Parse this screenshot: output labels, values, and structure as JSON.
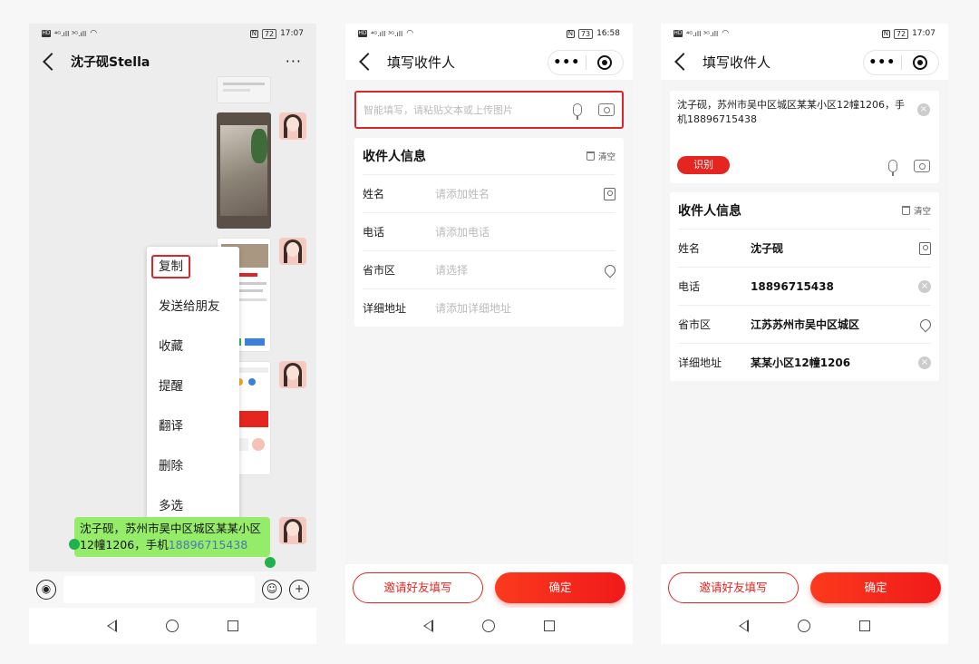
{
  "status": {
    "p1_time": "17:07",
    "p1_battery": "72",
    "p2_time": "16:58",
    "p2_battery": "73",
    "p3_time": "17:07",
    "p3_battery": "72"
  },
  "chat": {
    "contact_name": "沈子砚Stella",
    "message_part1": "沈子砚，苏州市吴中区城区某某小区12幢1206，手机",
    "message_phone": "18896715438",
    "context_menu": [
      "复制",
      "发送给朋友",
      "收藏",
      "提醒",
      "翻译",
      "删除",
      "多选"
    ]
  },
  "form_empty": {
    "title": "填写收件人",
    "smart_placeholder": "智能填写，请粘贴文本或上传图片",
    "section_title": "收件人信息",
    "clear_label": "清空",
    "rows": [
      {
        "label": "姓名",
        "value": "请添加姓名"
      },
      {
        "label": "电话",
        "value": "请添加电话"
      },
      {
        "label": "省市区",
        "value": "请选择"
      },
      {
        "label": "详细地址",
        "value": "请添加详细地址"
      }
    ],
    "invite_label": "邀请好友填写",
    "confirm_label": "确定"
  },
  "form_filled": {
    "title": "填写收件人",
    "pasted_text": "沈子砚，苏州市吴中区城区某某小区12幢1206，手机18896715438",
    "recognize_label": "识别",
    "section_title": "收件人信息",
    "clear_label": "清空",
    "rows": [
      {
        "label": "姓名",
        "value": "沈子砚"
      },
      {
        "label": "电话",
        "value": "18896715438"
      },
      {
        "label": "省市区",
        "value": "江苏苏州市吴中区城区"
      },
      {
        "label": "详细地址",
        "value": "某某小区12幢1206"
      }
    ],
    "invite_label": "邀请好友填写",
    "confirm_label": "确定"
  }
}
